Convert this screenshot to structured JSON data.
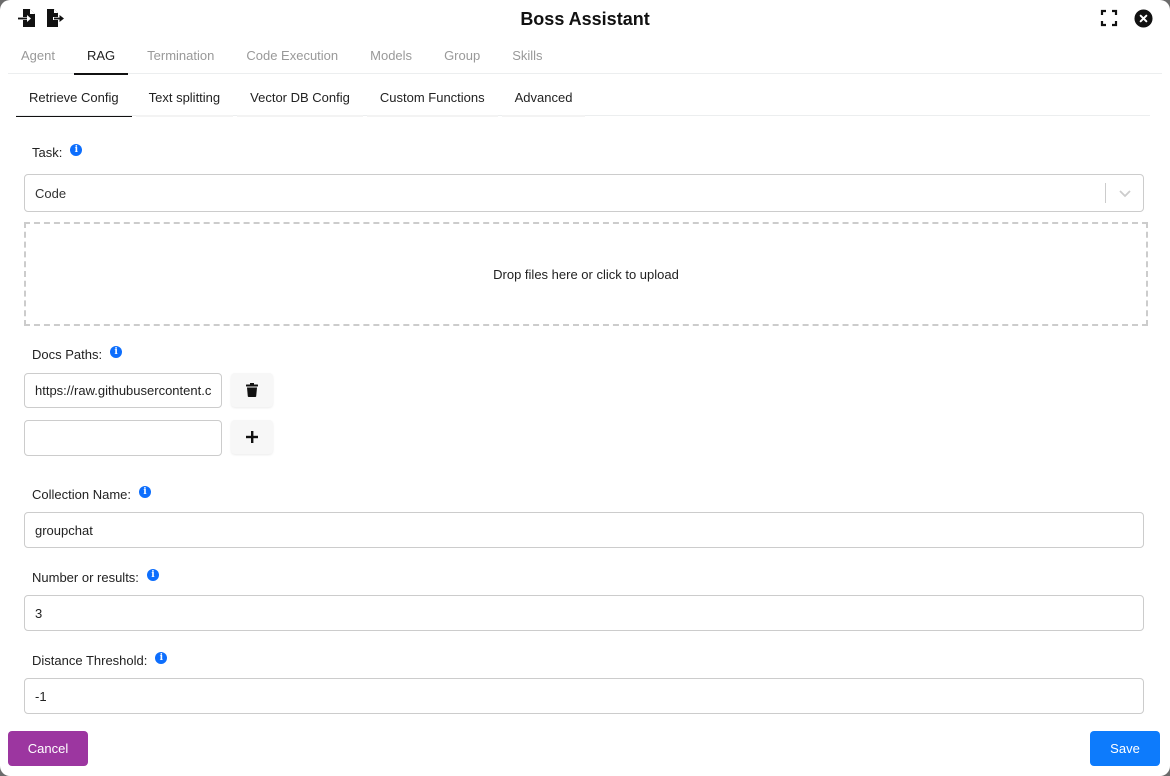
{
  "header": {
    "title": "Boss Assistant",
    "icons": {
      "import": "file-import-icon",
      "export": "file-export-icon",
      "fullscreen": "expand-icon",
      "close": "close-circle-icon"
    }
  },
  "tabs": [
    {
      "label": "Agent",
      "active": false
    },
    {
      "label": "RAG",
      "active": true
    },
    {
      "label": "Termination",
      "active": false
    },
    {
      "label": "Code Execution",
      "active": false
    },
    {
      "label": "Models",
      "active": false
    },
    {
      "label": "Group",
      "active": false
    },
    {
      "label": "Skills",
      "active": false
    }
  ],
  "subtabs": [
    {
      "label": "Retrieve Config",
      "active": true
    },
    {
      "label": "Text splitting",
      "active": false
    },
    {
      "label": "Vector DB Config",
      "active": false
    },
    {
      "label": "Custom Functions",
      "active": false
    },
    {
      "label": "Advanced",
      "active": false
    }
  ],
  "form": {
    "task": {
      "label": "Task:",
      "value": "Code"
    },
    "dropzone": {
      "text": "Drop files here or click to upload"
    },
    "docs_paths": {
      "label": "Docs Paths:",
      "values": [
        "https://raw.githubusercontent.c",
        ""
      ]
    },
    "collection_name": {
      "label": "Collection Name:",
      "value": "groupchat"
    },
    "number_results": {
      "label": "Number or results:",
      "value": "3"
    },
    "distance_threshold": {
      "label": "Distance Threshold:",
      "value": "-1"
    },
    "info_glyph": "i"
  },
  "footer": {
    "cancel_label": "Cancel",
    "save_label": "Save"
  },
  "colors": {
    "cancel": "#9c36a0",
    "save": "#0d7bfc",
    "info": "#0d6efd"
  }
}
